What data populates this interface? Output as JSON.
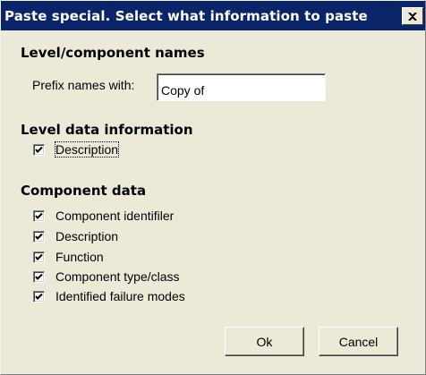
{
  "window": {
    "title": "Paste special. Select what information to paste",
    "close_icon": "close-icon"
  },
  "names_section": {
    "heading": "Level/component names",
    "prefix_label": "Prefix names with:",
    "prefix_value": "Copy of"
  },
  "level_section": {
    "heading": "Level data information",
    "items": [
      {
        "label": "Description",
        "checked": true
      }
    ]
  },
  "component_section": {
    "heading": "Component data",
    "items": [
      {
        "label": "Component identifiler",
        "checked": true
      },
      {
        "label": "Description",
        "checked": true
      },
      {
        "label": "Function",
        "checked": true
      },
      {
        "label": "Component type/class",
        "checked": true
      },
      {
        "label": "Identified failure modes",
        "checked": true
      }
    ]
  },
  "buttons": {
    "ok_label": "Ok",
    "cancel_label": "Cancel"
  },
  "colors": {
    "titlebar": "#0a246a",
    "face": "#ece9d8"
  }
}
